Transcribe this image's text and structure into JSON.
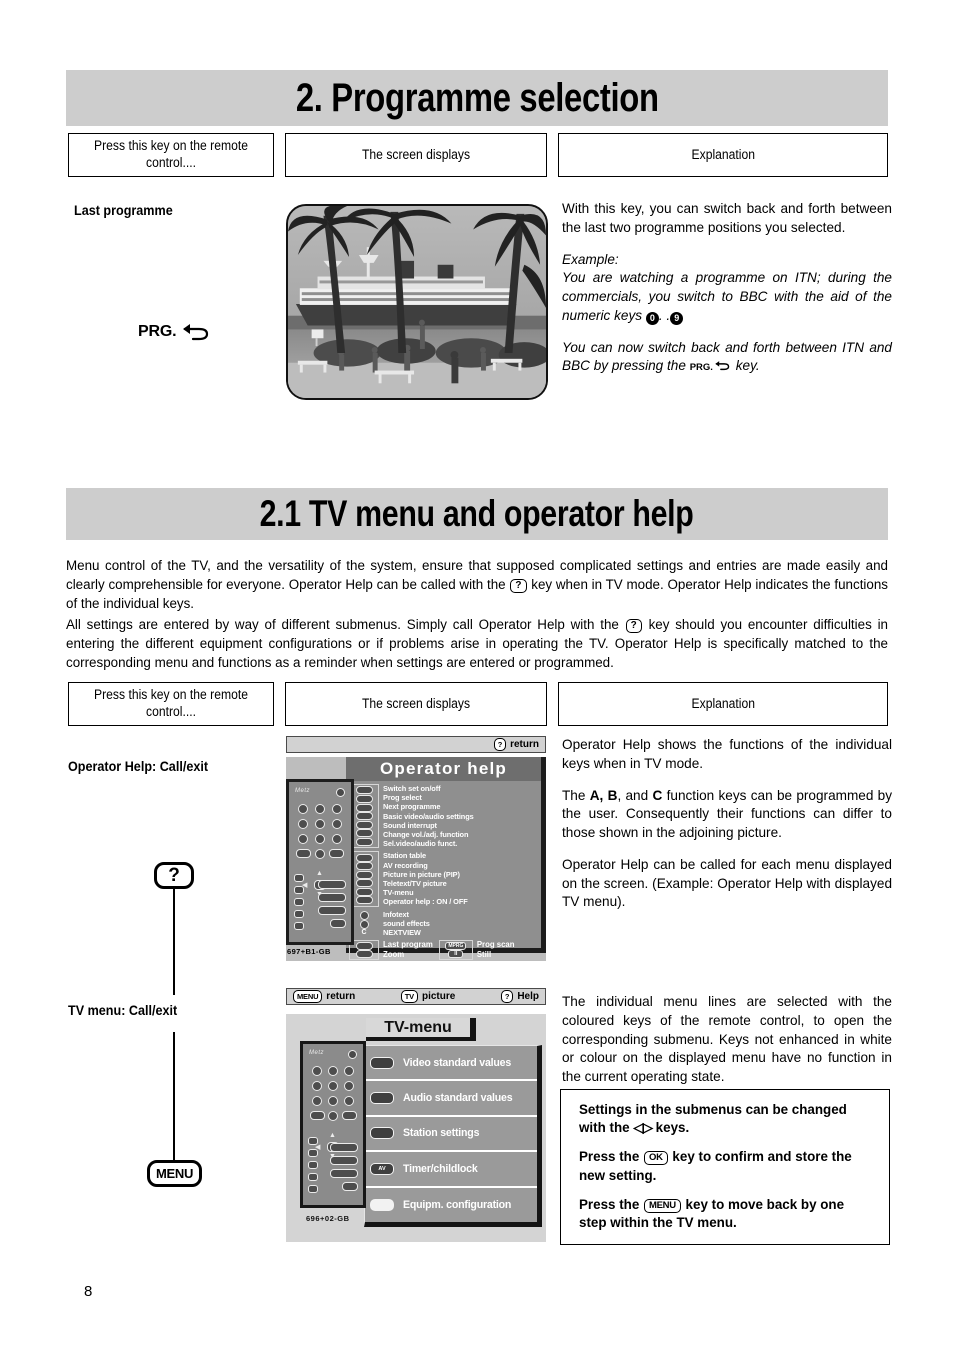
{
  "page": {
    "number": "8"
  },
  "section_2": {
    "heading": "2. Programme selection",
    "columns": {
      "key": "Press this key on the remote control....",
      "screen": "The screen displays",
      "explanation": "Explanation"
    },
    "row": {
      "label": "Last programme",
      "key_glyph_text": "PRG.",
      "key_glyph_icon": "return-arrow-icon",
      "photo_alt": "cruise-ship-palm-trees-photo",
      "explanation_p1": "With this key, you can switch back and forth between the last two programme positions you selected.",
      "explanation_example_label": "Example:",
      "explanation_example_line1": "You are watching a programme on ITN; during the commercials, you switch to BBC with the aid of the numeric keys",
      "numeric_key_low": "0",
      "numeric_key_sep": ". .",
      "numeric_key_high": "9",
      "explanation_p3_a": "You can now switch back and forth between ITN and BBC by pressing the",
      "explanation_p3_prg": "PRG.",
      "explanation_p3_b": "key."
    }
  },
  "section_2_1": {
    "heading": "2.1 TV menu and operator help",
    "intro_1_a": "Menu control of the TV, and the versatility of the system, ensure that supposed complicated settings and entries are made easily and clearly comprehensible for everyone. Operator Help can be called with the",
    "intro_1_key": "?",
    "intro_1_b": "key when in TV mode. Operator Help indicates the functions of the individual keys.",
    "intro_2_a": "All settings are entered by way of different submenus. Simply call Operator Help with the",
    "intro_2_key": "?",
    "intro_2_b": "key should you encounter difficulties in entering the different equipment configurations or if problems arise in operating the TV. Operator Help is specifically matched to the corresponding menu and functions as a reminder when settings are entered or programmed.",
    "columns": {
      "key": "Press this key on the remote control....",
      "screen": "The screen displays",
      "explanation": "Explanation"
    },
    "row_operator_help": {
      "label": "Operator Help: Call/exit",
      "key_glyph": "?",
      "explanation_p1": "Operator Help shows the functions of the individual keys when in TV mode.",
      "explanation_p2_a": "The",
      "explanation_p2_keys": "A, B",
      "explanation_p2_and": ", and",
      "explanation_p2_key_c": "C",
      "explanation_p2_b": "function keys can be programmed by the user. Consequently their functions can differ to those shown in the adjoining picture.",
      "explanation_p3": "Operator Help can be called for each menu displayed on the screen. (Example: Operator Help with displayed TV menu)."
    },
    "row_tv_menu": {
      "label": "TV menu: Call/exit",
      "key_glyph": "MENU",
      "explanation_p1": "The individual menu lines are selected with the coloured keys of the remote control, to open the corresponding submenu. Keys not enhanced in white or colour on the displayed menu have no function in the current operating state.",
      "note_p1_a": "Settings in the submenus can be changed with the",
      "note_p1_keys": "left/right-arrow-keys-icon",
      "note_p1_b": "keys.",
      "note_p2_a": "Press the",
      "note_p2_key": "OK",
      "note_p2_b": "key to confirm and store the new setting.",
      "note_p3_a": "Press the",
      "note_p3_key": "MENU",
      "note_p3_b": "key to move back by one step within the TV menu."
    }
  },
  "osd_operator_help": {
    "top_bar": {
      "return_key": "?",
      "return_label": "return"
    },
    "title": "Operator help",
    "groups": [
      {
        "items": [
          "Switch set on/off",
          "Prog select",
          "Next programme",
          "Basic video/audio settings",
          "Sound interrupt",
          "Change vol./adj. function",
          "Sel.video/audio funct."
        ]
      },
      {
        "items": [
          "Station table",
          "AV recording",
          "Picture in picture (PIP)",
          "Teletext/TV picture",
          "TV-menu",
          "Operator help : ON / OFF"
        ]
      },
      {
        "items": [
          "Infotext",
          "sound effects",
          "NEXTVIEW"
        ]
      }
    ],
    "bottom_left": [
      "Last program",
      "Zoom"
    ],
    "bottom_right": [
      "Prog scan",
      "Still"
    ],
    "bottom_right_icon_labels": [
      "MPRG",
      "II"
    ],
    "nextview_icon_label": "C",
    "remote_code": "697+B1-GB"
  },
  "osd_tv_menu": {
    "top_bar": {
      "menu_key": "MENU",
      "menu_label": "return",
      "tv_key": "TV",
      "tv_label": "picture",
      "help_key": "?",
      "help_label": "Help"
    },
    "title": "TV-menu",
    "rows": [
      {
        "icon": "video-icon",
        "icon_label": "",
        "label": "Video standard values"
      },
      {
        "icon": "audio-icon",
        "icon_label": "",
        "label": "Audio standard values"
      },
      {
        "icon": "station-icon",
        "icon_label": "",
        "label": "Station settings"
      },
      {
        "icon": "av-icon",
        "icon_label": "AV",
        "label": "Timer/childlock"
      },
      {
        "icon": "blank-icon",
        "icon_label": "",
        "label": "Equipm. configuration"
      }
    ],
    "remote_code": "696+02-GB"
  },
  "colors": {
    "banner_grey": "#cdcdcd",
    "osd_panel_grey": "#8f8f8f",
    "osd_title_grey": "#6e6e6e",
    "osd_bar_grey": "#d2d2d2"
  }
}
